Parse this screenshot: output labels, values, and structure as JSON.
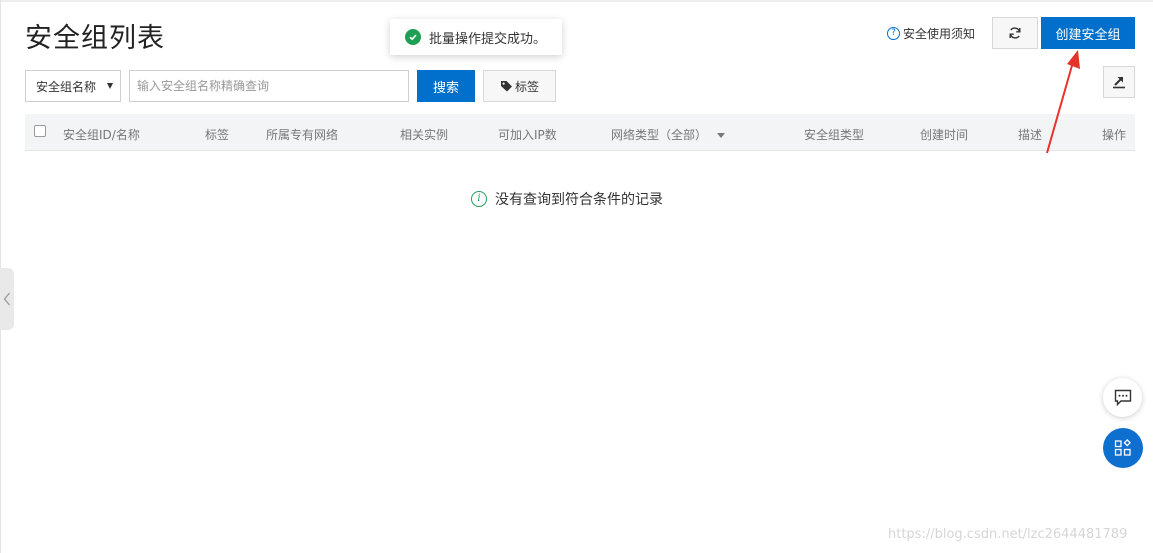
{
  "page": {
    "title": "安全组列表"
  },
  "toast": {
    "message": "批量操作提交成功。"
  },
  "header": {
    "help_label": "安全使用须知",
    "create_label": "创建安全组"
  },
  "filter": {
    "select_value": "安全组名称",
    "search_placeholder": "输入安全组名称精确查询",
    "search_label": "搜索",
    "tag_label": "标签"
  },
  "table": {
    "columns": [
      "安全组ID/名称",
      "标签",
      "所属专有网络",
      "相关实例",
      "可加入IP数",
      "网络类型（全部）",
      "安全组类型",
      "创建时间",
      "描述",
      "操作"
    ],
    "rows": []
  },
  "empty_state": {
    "message": "没有查询到符合条件的记录"
  },
  "watermark": "https://blog.csdn.net/lzc2644481789",
  "colors": {
    "primary": "#0070cc",
    "success": "#1e9f55",
    "annotation": "#e8332a"
  },
  "icons": [
    "check-circle-icon",
    "help-icon",
    "refresh-icon",
    "tag-icon",
    "export-icon",
    "info-icon",
    "chevron-left-icon",
    "chat-icon",
    "apps-icon",
    "annotation-arrow"
  ]
}
